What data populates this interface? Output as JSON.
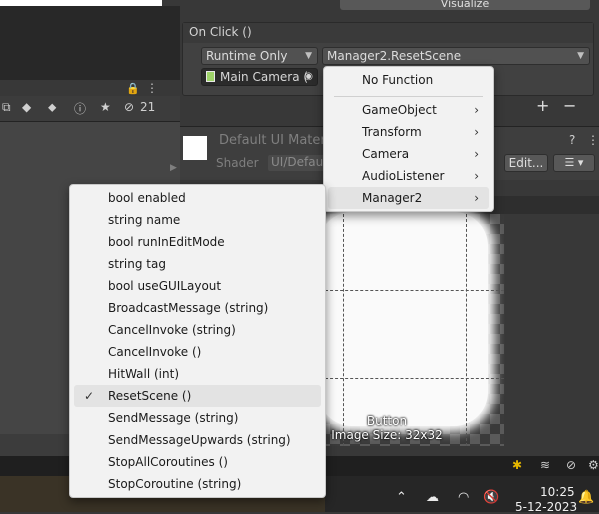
{
  "inspector": {
    "visualize_label": "Visualize",
    "on_click_header": "On Click ()",
    "runtime_dropdown": "Runtime Only",
    "method_dropdown": "Manager2.ResetScene",
    "target_object": "Main Camera (",
    "plus_label": "+",
    "minus_label": "−",
    "material_name": "Default UI Mater",
    "shader_label": "Shader",
    "shader_value": "UI/Defau",
    "edit_label": "Edit...",
    "list_label": "☰ ▾",
    "help_icon": "?",
    "more_icon": "⋮"
  },
  "left_toolbar": {
    "lock_icon": "🔒",
    "more_icon": "⋮",
    "hidden_count": "21"
  },
  "preview": {
    "title": "Button",
    "image_size": "Image Size: 32x32"
  },
  "component_menu": {
    "items": [
      {
        "label": "No Function",
        "arrow": ""
      },
      {
        "label": "GameObject",
        "arrow": "›"
      },
      {
        "label": "Transform",
        "arrow": "›"
      },
      {
        "label": "Camera",
        "arrow": "›"
      },
      {
        "label": "AudioListener",
        "arrow": "›"
      },
      {
        "label": "Manager2",
        "arrow": "›"
      }
    ],
    "highlighted_index": 5
  },
  "function_menu": {
    "items": [
      {
        "label": "bool enabled",
        "checked": false
      },
      {
        "label": "string name",
        "checked": false
      },
      {
        "label": "bool runInEditMode",
        "checked": false
      },
      {
        "label": "string tag",
        "checked": false
      },
      {
        "label": "bool useGUILayout",
        "checked": false
      },
      {
        "label": "BroadcastMessage (string)",
        "checked": false
      },
      {
        "label": "CancelInvoke (string)",
        "checked": false
      },
      {
        "label": "CancelInvoke ()",
        "checked": false
      },
      {
        "label": "HitWall (int)",
        "checked": false
      },
      {
        "label": "ResetScene ()",
        "checked": true
      },
      {
        "label": "SendMessage (string)",
        "checked": false
      },
      {
        "label": "SendMessageUpwards (string)",
        "checked": false
      },
      {
        "label": "StopAllCoroutines ()",
        "checked": false
      },
      {
        "label": "StopCoroutine (string)",
        "checked": false
      }
    ],
    "check_glyph": "✓"
  },
  "taskbar": {
    "time": "10:25",
    "date": "5-12-2023"
  }
}
